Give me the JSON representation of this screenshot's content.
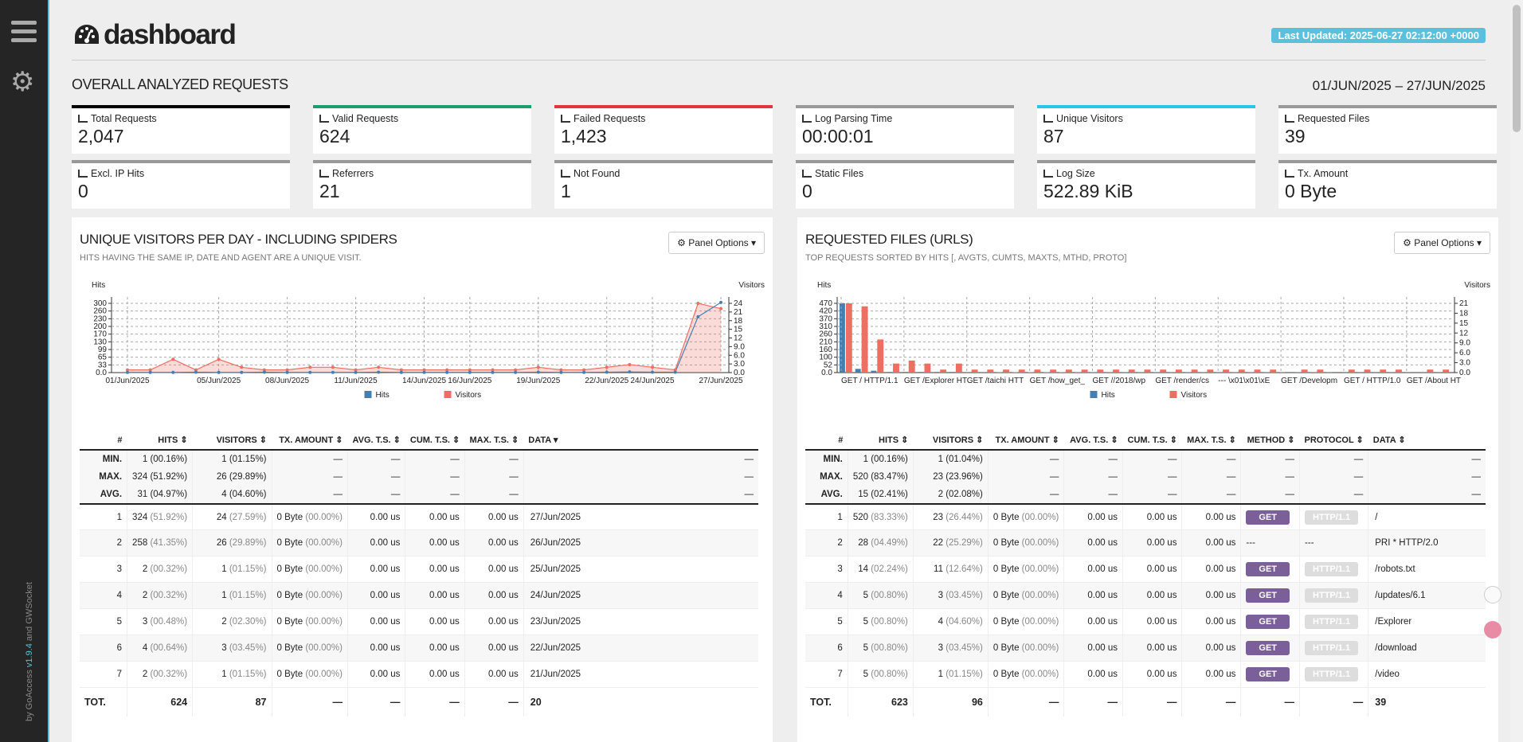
{
  "header": {
    "title": "dashboard",
    "last_updated": "Last Updated: 2025-06-27 02:12:00 +0000"
  },
  "sidebar": {
    "credits_by": "by",
    "credits_app": "GoAccess",
    "credits_version": "v1.9.4",
    "credits_and": "and",
    "credits_ws": "GWSocket"
  },
  "overview": {
    "title": "OVERALL ANALYZED REQUESTS",
    "date_range": "01/JUN/2025 – 27/JUN/2025",
    "cards": [
      {
        "label": "Total Requests",
        "value": "2,047",
        "color": "#000000"
      },
      {
        "label": "Valid Requests",
        "value": "624",
        "color": "#1a9e6c"
      },
      {
        "label": "Failed Requests",
        "value": "1,423",
        "color": "#e23542"
      },
      {
        "label": "Log Parsing Time",
        "value": "00:00:01",
        "color": "#999999"
      },
      {
        "label": "Unique Visitors",
        "value": "87",
        "color": "#29c4e8"
      },
      {
        "label": "Requested Files",
        "value": "39",
        "color": "#999999"
      },
      {
        "label": "Excl. IP Hits",
        "value": "0",
        "color": "#999999"
      },
      {
        "label": "Referrers",
        "value": "21",
        "color": "#999999"
      },
      {
        "label": "Not Found",
        "value": "1",
        "color": "#999999"
      },
      {
        "label": "Static Files",
        "value": "0",
        "color": "#999999"
      },
      {
        "label": "Log Size",
        "value": "522.89 KiB",
        "color": "#999999"
      },
      {
        "label": "Tx. Amount",
        "value": "0 Byte",
        "color": "#999999"
      }
    ]
  },
  "visitors_panel": {
    "title": "UNIQUE VISITORS PER DAY - INCLUDING SPIDERS",
    "subtitle": "HITS HAVING THE SAME IP, DATE AND AGENT ARE A UNIQUE VISIT.",
    "options_label": "Panel Options",
    "columns": [
      "#",
      "HITS",
      "VISITORS",
      "TX. AMOUNT",
      "AVG. T.S.",
      "CUM. T.S.",
      "MAX. T.S.",
      "DATA"
    ],
    "stats": [
      {
        "label": "MIN.",
        "hits": "1",
        "hits_pct": "(00.16%)",
        "vis": "1",
        "vis_pct": "(01.15%)"
      },
      {
        "label": "MAX.",
        "hits": "324",
        "hits_pct": "(51.92%)",
        "vis": "26",
        "vis_pct": "(29.89%)"
      },
      {
        "label": "AVG.",
        "hits": "31",
        "hits_pct": "(04.97%)",
        "vis": "4",
        "vis_pct": "(04.60%)"
      }
    ],
    "dash": "—",
    "rows": [
      {
        "n": "1",
        "hits": "324",
        "hits_pct": "(51.92%)",
        "vis": "24",
        "vis_pct": "(27.59%)",
        "tx": "0 Byte",
        "tx_pct": "(00.00%)",
        "avg": "0.00 us",
        "cum": "0.00 us",
        "max": "0.00 us",
        "data": "27/Jun/2025"
      },
      {
        "n": "2",
        "hits": "258",
        "hits_pct": "(41.35%)",
        "vis": "26",
        "vis_pct": "(29.89%)",
        "tx": "0 Byte",
        "tx_pct": "(00.00%)",
        "avg": "0.00 us",
        "cum": "0.00 us",
        "max": "0.00 us",
        "data": "26/Jun/2025"
      },
      {
        "n": "3",
        "hits": "2",
        "hits_pct": "(00.32%)",
        "vis": "1",
        "vis_pct": "(01.15%)",
        "tx": "0 Byte",
        "tx_pct": "(00.00%)",
        "avg": "0.00 us",
        "cum": "0.00 us",
        "max": "0.00 us",
        "data": "25/Jun/2025"
      },
      {
        "n": "4",
        "hits": "2",
        "hits_pct": "(00.32%)",
        "vis": "1",
        "vis_pct": "(01.15%)",
        "tx": "0 Byte",
        "tx_pct": "(00.00%)",
        "avg": "0.00 us",
        "cum": "0.00 us",
        "max": "0.00 us",
        "data": "24/Jun/2025"
      },
      {
        "n": "5",
        "hits": "3",
        "hits_pct": "(00.48%)",
        "vis": "2",
        "vis_pct": "(02.30%)",
        "tx": "0 Byte",
        "tx_pct": "(00.00%)",
        "avg": "0.00 us",
        "cum": "0.00 us",
        "max": "0.00 us",
        "data": "23/Jun/2025"
      },
      {
        "n": "6",
        "hits": "4",
        "hits_pct": "(00.64%)",
        "vis": "3",
        "vis_pct": "(03.45%)",
        "tx": "0 Byte",
        "tx_pct": "(00.00%)",
        "avg": "0.00 us",
        "cum": "0.00 us",
        "max": "0.00 us",
        "data": "22/Jun/2025"
      },
      {
        "n": "7",
        "hits": "2",
        "hits_pct": "(00.32%)",
        "vis": "1",
        "vis_pct": "(01.15%)",
        "tx": "0 Byte",
        "tx_pct": "(00.00%)",
        "avg": "0.00 us",
        "cum": "0.00 us",
        "max": "0.00 us",
        "data": "21/Jun/2025"
      }
    ],
    "total": {
      "label": "TOT.",
      "hits": "624",
      "vis": "87",
      "data": "20"
    }
  },
  "requests_panel": {
    "title": "REQUESTED FILES (URLS)",
    "subtitle": "TOP REQUESTS SORTED BY HITS [, AVGTS, CUMTS, MAXTS, MTHD, PROTO]",
    "options_label": "Panel Options",
    "columns": [
      "#",
      "HITS",
      "VISITORS",
      "TX. AMOUNT",
      "AVG. T.S.",
      "CUM. T.S.",
      "MAX. T.S.",
      "METHOD",
      "PROTOCOL",
      "DATA"
    ],
    "stats": [
      {
        "label": "MIN.",
        "hits": "1",
        "hits_pct": "(00.16%)",
        "vis": "1",
        "vis_pct": "(01.04%)"
      },
      {
        "label": "MAX.",
        "hits": "520",
        "hits_pct": "(83.47%)",
        "vis": "23",
        "vis_pct": "(23.96%)"
      },
      {
        "label": "AVG.",
        "hits": "15",
        "hits_pct": "(02.41%)",
        "vis": "2",
        "vis_pct": "(02.08%)"
      }
    ],
    "dash": "—",
    "rows": [
      {
        "n": "1",
        "hits": "520",
        "hits_pct": "(83.33%)",
        "vis": "23",
        "vis_pct": "(26.44%)",
        "tx": "0 Byte",
        "tx_pct": "(00.00%)",
        "avg": "0.00 us",
        "cum": "0.00 us",
        "max": "0.00 us",
        "method": "GET",
        "proto": "HTTP/1.1",
        "data": "/"
      },
      {
        "n": "2",
        "hits": "28",
        "hits_pct": "(04.49%)",
        "vis": "22",
        "vis_pct": "(25.29%)",
        "tx": "0 Byte",
        "tx_pct": "(00.00%)",
        "avg": "0.00 us",
        "cum": "0.00 us",
        "max": "0.00 us",
        "method": "---",
        "proto": "---",
        "data": "PRI * HTTP/2.0"
      },
      {
        "n": "3",
        "hits": "14",
        "hits_pct": "(02.24%)",
        "vis": "11",
        "vis_pct": "(12.64%)",
        "tx": "0 Byte",
        "tx_pct": "(00.00%)",
        "avg": "0.00 us",
        "cum": "0.00 us",
        "max": "0.00 us",
        "method": "GET",
        "proto": "HTTP/1.1",
        "data": "/robots.txt"
      },
      {
        "n": "4",
        "hits": "5",
        "hits_pct": "(00.80%)",
        "vis": "3",
        "vis_pct": "(03.45%)",
        "tx": "0 Byte",
        "tx_pct": "(00.00%)",
        "avg": "0.00 us",
        "cum": "0.00 us",
        "max": "0.00 us",
        "method": "GET",
        "proto": "HTTP/1.1",
        "data": "/updates/6.1"
      },
      {
        "n": "5",
        "hits": "5",
        "hits_pct": "(00.80%)",
        "vis": "4",
        "vis_pct": "(04.60%)",
        "tx": "0 Byte",
        "tx_pct": "(00.00%)",
        "avg": "0.00 us",
        "cum": "0.00 us",
        "max": "0.00 us",
        "method": "GET",
        "proto": "HTTP/1.1",
        "data": "/Explorer"
      },
      {
        "n": "6",
        "hits": "5",
        "hits_pct": "(00.80%)",
        "vis": "3",
        "vis_pct": "(03.45%)",
        "tx": "0 Byte",
        "tx_pct": "(00.00%)",
        "avg": "0.00 us",
        "cum": "0.00 us",
        "max": "0.00 us",
        "method": "GET",
        "proto": "HTTP/1.1",
        "data": "/download"
      },
      {
        "n": "7",
        "hits": "5",
        "hits_pct": "(00.80%)",
        "vis": "1",
        "vis_pct": "(01.15%)",
        "tx": "0 Byte",
        "tx_pct": "(00.00%)",
        "avg": "0.00 us",
        "cum": "0.00 us",
        "max": "0.00 us",
        "method": "GET",
        "proto": "HTTP/1.1",
        "data": "/video"
      }
    ],
    "total": {
      "label": "TOT.",
      "hits": "623",
      "vis": "96",
      "data": "39"
    }
  },
  "chart_data": [
    {
      "type": "area",
      "ylabel_left": "Hits",
      "ylabel_right": "Visitors",
      "y_left_ticks": [
        "0.0",
        "33",
        "65",
        "99",
        "130",
        "170",
        "200",
        "230",
        "260",
        "300"
      ],
      "y_left_range": [
        0,
        320
      ],
      "y_right_ticks": [
        "0.0",
        "3.0",
        "6.0",
        "9.0",
        "12",
        "15",
        "18",
        "21",
        "24"
      ],
      "y_right_range": [
        0,
        26
      ],
      "x_tick_labels": [
        "01/Jun/2025",
        "05/Jun/2025",
        "08/Jun/2025",
        "11/Jun/2025",
        "14/Jun/2025",
        "16/Jun/2025",
        "19/Jun/2025",
        "22/Jun/2025",
        "24/Jun/2025",
        "27/Jun/2025"
      ],
      "legend": [
        "Hits",
        "Visitors"
      ],
      "colors": {
        "hits": "#447fb4",
        "visitors": "#ef6e62"
      },
      "series": [
        {
          "name": "Hits",
          "values": [
            1,
            1,
            1,
            2,
            1,
            1,
            2,
            1,
            1,
            1,
            1,
            2,
            1,
            1,
            1,
            1,
            1,
            1,
            2,
            1,
            1,
            2,
            3,
            2,
            2,
            258,
            324
          ]
        },
        {
          "name": "Visitors",
          "values": [
            1,
            1,
            5,
            1,
            5,
            2,
            1,
            1,
            2,
            2,
            1,
            2,
            1,
            1,
            1,
            1,
            1,
            1,
            2,
            1,
            1,
            2,
            3,
            2,
            1,
            26,
            24
          ]
        }
      ]
    },
    {
      "type": "bar",
      "ylabel_left": "Hits",
      "ylabel_right": "Visitors",
      "y_left_ticks": [
        "0.0",
        "52",
        "100",
        "160",
        "210",
        "260",
        "310",
        "370",
        "420",
        "470"
      ],
      "y_left_range": [
        0,
        520
      ],
      "y_right_ticks": [
        "0.0",
        "3.0",
        "6.0",
        "9.0",
        "12",
        "15",
        "18",
        "21"
      ],
      "y_right_range": [
        0,
        23
      ],
      "x_tick_labels": [
        "GET / HTTP/1.1",
        "GET /Explorer HT",
        "GET /taichi HTT",
        "GET /how_get_",
        "GET //2018/wp",
        "GET /render/cs",
        "--- \\x01\\x01\\xE",
        "GET /Developm",
        "GET / HTTP/1.0",
        "GET /About HT"
      ],
      "legend": [
        "Hits",
        "Visitors"
      ],
      "colors": {
        "hits": "#447fb4",
        "visitors": "#ef6e62"
      },
      "series": [
        {
          "name": "Hits",
          "values": [
            520,
            28,
            14,
            5,
            5,
            5,
            5,
            5,
            4,
            4,
            3,
            3,
            3,
            3,
            3,
            2,
            2,
            2,
            2,
            2,
            2,
            2,
            2,
            2,
            2,
            2,
            2,
            2,
            2,
            2,
            2,
            2,
            1,
            1,
            1,
            1,
            1,
            1,
            1
          ]
        },
        {
          "name": "Visitors",
          "values": [
            23,
            22,
            11,
            3,
            4,
            3,
            1,
            3,
            1,
            1,
            1,
            1,
            1,
            1,
            1,
            1,
            1,
            1,
            1,
            1,
            1,
            1,
            1,
            1,
            1,
            1,
            1,
            1,
            0,
            1,
            1,
            0,
            1,
            1,
            1,
            1,
            0,
            1,
            1
          ]
        }
      ]
    }
  ]
}
